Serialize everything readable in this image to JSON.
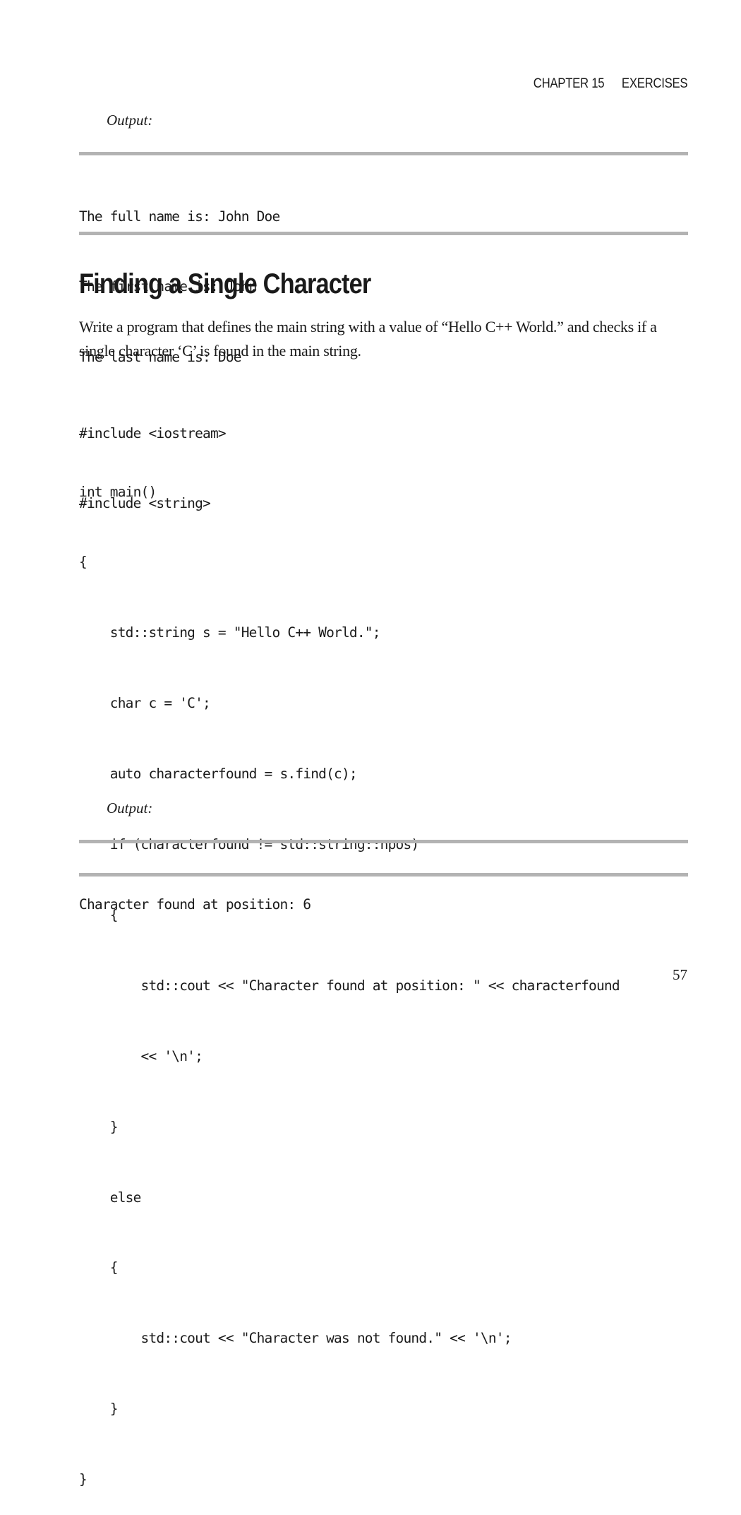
{
  "running_head": {
    "chapter": "CHAPTER 15",
    "title": "EXERCISES"
  },
  "previous_output": {
    "label": "Output:",
    "lines": [
      "The full name is: John Doe",
      "The first name is: John",
      "The last name is: Doe"
    ]
  },
  "section": {
    "heading": "Finding a Single Character",
    "paragraph": "Write a program that defines the main string with a value of “Hello C++ World.” and checks if a single character ‘C’ is found in the main string."
  },
  "code": {
    "includes": [
      "#include <iostream>",
      "#include <string>"
    ],
    "body": [
      "int main()",
      "{",
      "    std::string s = \"Hello C++ World.\";",
      "    char c = 'C';",
      "    auto characterfound = s.find(c);",
      "    if (characterfound != std::string::npos)",
      "    {",
      "        std::cout << \"Character found at position: \" << characterfound",
      "        << '\\n';",
      "    }",
      "    else",
      "    {",
      "        std::cout << \"Character was not found.\" << '\\n';",
      "    }",
      "}"
    ]
  },
  "result_output": {
    "label": "Output:",
    "lines": [
      "Character found at position: 6"
    ]
  },
  "page_number": "57"
}
